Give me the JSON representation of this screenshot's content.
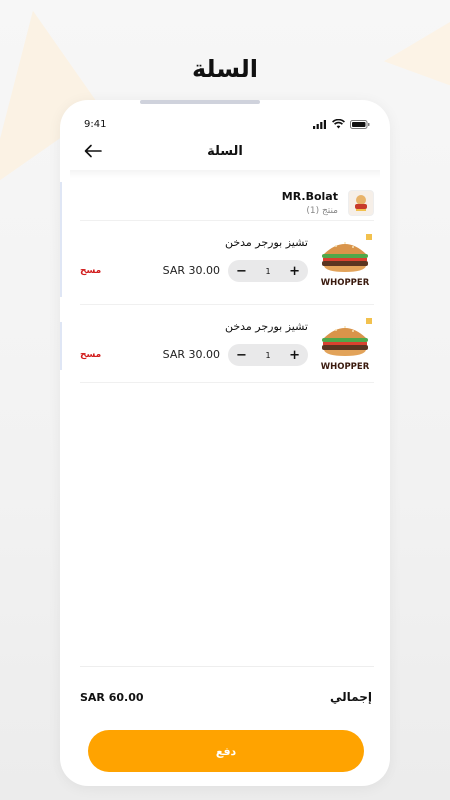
{
  "page": {
    "heading": "السلة"
  },
  "status_bar": {
    "time": "9:41"
  },
  "nav": {
    "title": "السلة"
  },
  "store": {
    "name": "MR.Bolat",
    "count": "(1) منتج"
  },
  "items": [
    {
      "name": "تشيز بورجر مدخن",
      "price": "SAR 30.00",
      "quantity": "1",
      "delete_label": "مسح",
      "image_label": "WHOPPER"
    },
    {
      "name": "تشيز بورجر مدخن",
      "price": "SAR 30.00",
      "quantity": "1",
      "delete_label": "مسح",
      "image_label": "WHOPPER"
    }
  ],
  "stepper": {
    "minus": "−",
    "plus": "+"
  },
  "summary": {
    "total_label": "إجمالي",
    "total_amount": "SAR 60.00"
  },
  "actions": {
    "pay_label": "دفع"
  },
  "colors": {
    "accent": "#ffa300",
    "delete": "#d11b1b",
    "stepper_bg": "#e9e9ea"
  }
}
